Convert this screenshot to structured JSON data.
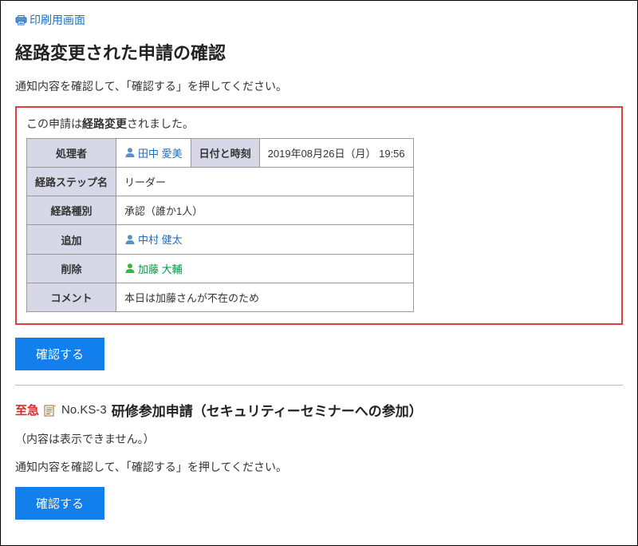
{
  "print_link_label": "印刷用画面",
  "page_title": "経路変更された申請の確認",
  "instruction_text": "通知内容を確認して、「確認する」を押してください。",
  "notice": {
    "prefix": "この申請は",
    "bold": "経路変更",
    "suffix": "されました。"
  },
  "table": {
    "processor_label": "処理者",
    "processor_name": "田中 愛美",
    "datetime_label": "日付と時刻",
    "datetime_value": "2019年08月26日（月） 19:56",
    "step_name_label": "経路ステップ名",
    "step_name_value": "リーダー",
    "route_type_label": "経路種別",
    "route_type_value": "承認（誰か1人）",
    "added_label": "追加",
    "added_name": "中村 健太",
    "removed_label": "削除",
    "removed_name": "加藤 大輔",
    "comment_label": "コメント",
    "comment_value": "本日は加藤さんが不在のため"
  },
  "confirm_button_label": "確認する",
  "second": {
    "urgent_label": "至急",
    "app_number": "No.KS-3",
    "app_title": "研修参加申請（セキュリティーセミナーへの参加）",
    "no_content_text": "（内容は表示できません。）",
    "instruction_text": "通知内容を確認して、「確認する」を押してください。",
    "confirm_button_label": "確認する"
  }
}
